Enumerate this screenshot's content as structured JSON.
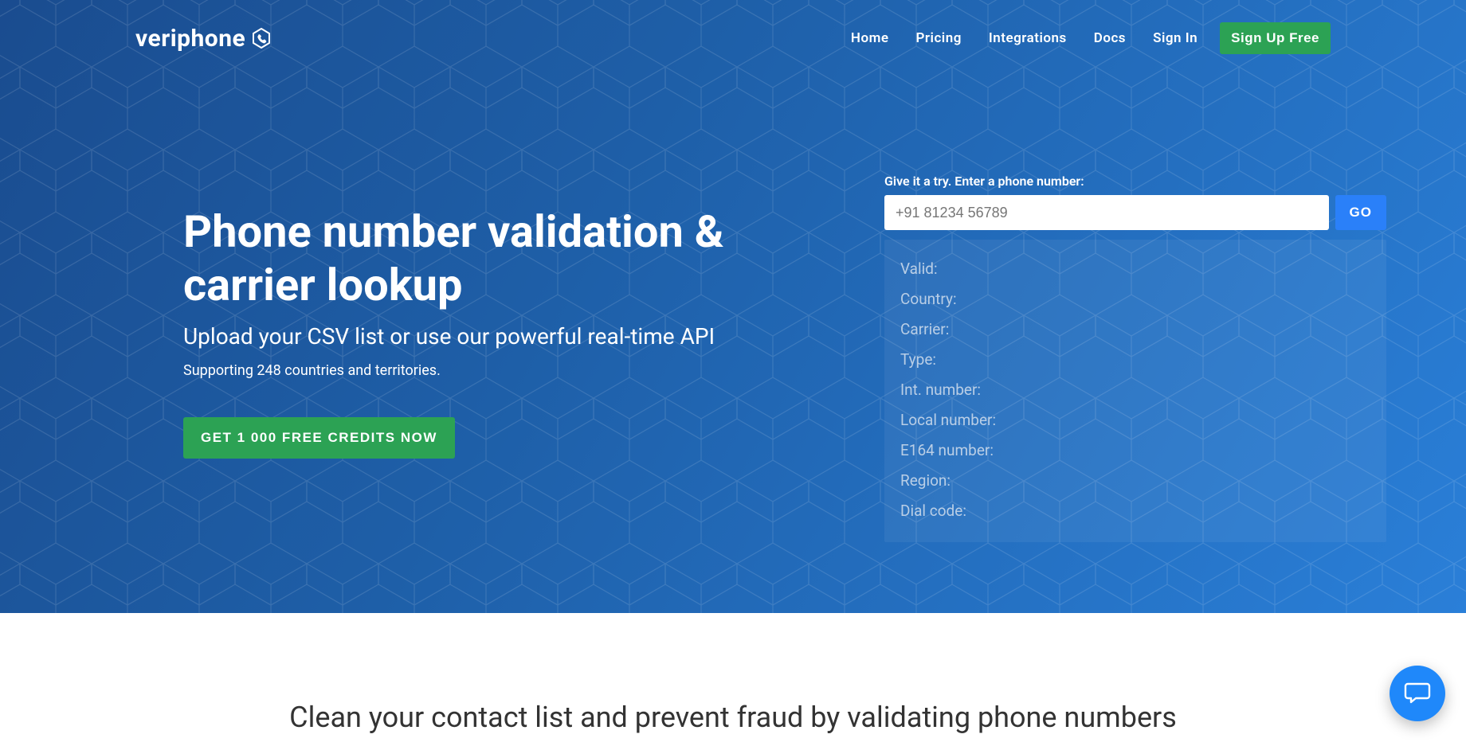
{
  "brand": "veriphone",
  "nav": {
    "home": "Home",
    "pricing": "Pricing",
    "integrations": "Integrations",
    "docs": "Docs",
    "signin": "Sign In",
    "signup": "Sign Up Free"
  },
  "hero": {
    "title": "Phone number validation & carrier lookup",
    "subtitle": "Upload your CSV list or use our powerful real-time API",
    "supporting": "Supporting 248 countries and territories.",
    "cta": "GET 1 000 FREE CREDITS NOW"
  },
  "tryit": {
    "label": "Give it a try. Enter a phone number:",
    "placeholder": "+91 81234 56789",
    "value": "",
    "go": "GO",
    "fields": {
      "valid": "Valid:",
      "country": "Country:",
      "carrier": "Carrier:",
      "type": "Type:",
      "intnumber": "Int. number:",
      "localnumber": "Local number:",
      "e164number": "E164 number:",
      "region": "Region:",
      "dialcode": "Dial code:"
    }
  },
  "section2": {
    "headline": "Clean your contact list and prevent fraud by validating phone numbers"
  }
}
